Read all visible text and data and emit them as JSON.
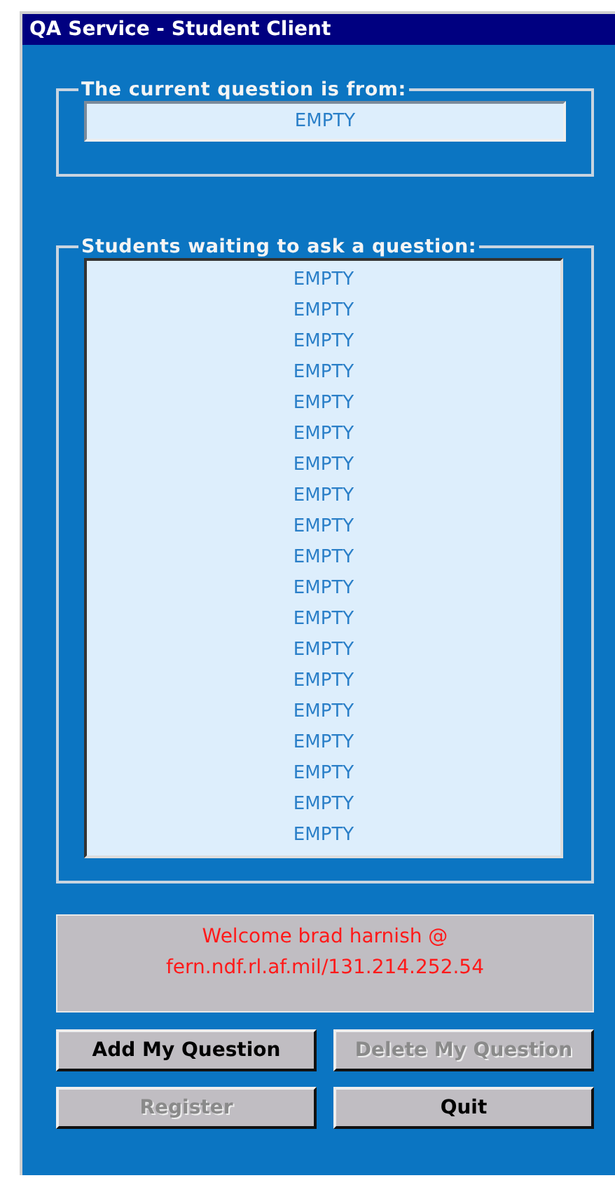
{
  "window": {
    "title": "QA Service - Student Client"
  },
  "current_question": {
    "label": "The current question is from:",
    "value": "EMPTY"
  },
  "waiting": {
    "label": "Students waiting to ask a question:",
    "items": [
      "EMPTY",
      "EMPTY",
      "EMPTY",
      "EMPTY",
      "EMPTY",
      "EMPTY",
      "EMPTY",
      "EMPTY",
      "EMPTY",
      "EMPTY",
      "EMPTY",
      "EMPTY",
      "EMPTY",
      "EMPTY",
      "EMPTY",
      "EMPTY",
      "EMPTY",
      "EMPTY",
      "EMPTY"
    ]
  },
  "message": [
    "Welcome brad harnish @",
    "fern.ndf.rl.af.mil/131.214.252.54"
  ],
  "buttons": [
    {
      "label": "Add My Question",
      "disabled": false
    },
    {
      "label": "Delete My Question",
      "disabled": true
    },
    {
      "label": "Register",
      "disabled": true
    },
    {
      "label": "Quit",
      "disabled": false
    }
  ]
}
